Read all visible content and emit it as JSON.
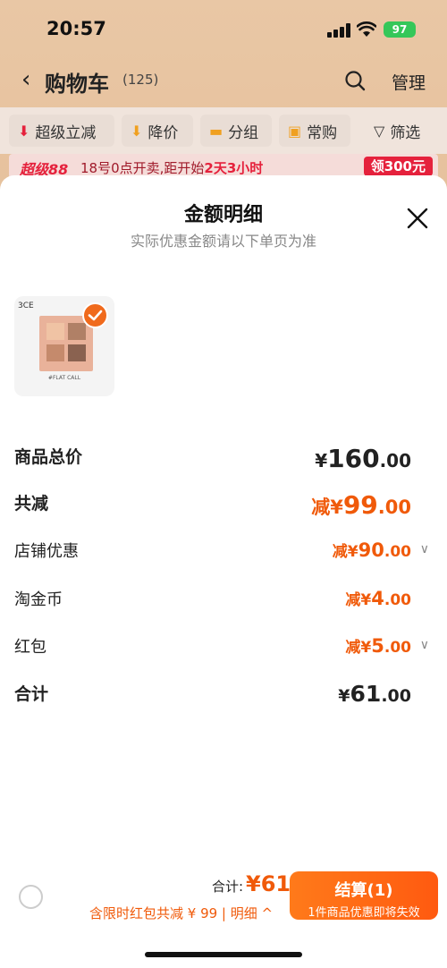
{
  "status_bar": {
    "time": "20:57",
    "battery": "97"
  },
  "header": {
    "title": "购物车",
    "count": "(125)",
    "manage": "管理"
  },
  "filters": [
    {
      "label": "超级立减",
      "icon": "arrow-down-icon"
    },
    {
      "label": "降价",
      "icon": "price-drop-icon"
    },
    {
      "label": "分组",
      "icon": "folder-icon"
    },
    {
      "label": "常购",
      "icon": "cart-icon"
    },
    {
      "label": "筛选",
      "icon": "filter-icon"
    }
  ],
  "promo": {
    "tag": "超级88",
    "text_a": "18号0点开卖,距开始",
    "text_b": "2天3小时",
    "coupon": "领300元"
  },
  "sheet": {
    "title": "金额明细",
    "subtitle": "实际优惠金额请以下单页为准",
    "product_brand": "3CE",
    "product_caption": "#FLAT CALL",
    "rows": [
      {
        "label": "商品总价",
        "currency": "¥",
        "int": "160",
        "dec": ".00",
        "prefix": ""
      },
      {
        "label": "共减",
        "currency": "¥",
        "int": "99",
        "dec": ".00",
        "prefix": "减"
      },
      {
        "label": "店铺优惠",
        "currency": "¥",
        "int": "90",
        "dec": ".00",
        "prefix": "减"
      },
      {
        "label": "淘金币",
        "currency": "¥",
        "int": "4",
        "dec": ".00",
        "prefix": "减"
      },
      {
        "label": "红包",
        "currency": "¥",
        "int": "5",
        "dec": ".00",
        "prefix": "减"
      },
      {
        "label": "合计",
        "currency": "¥",
        "int": "61",
        "dec": ".00",
        "prefix": ""
      }
    ]
  },
  "bottom": {
    "total_label": "合计:",
    "total_value": "¥61",
    "discount": "含限时红包共减 ¥ 99 | 明细 ^",
    "checkout_label": "结算(1)",
    "checkout_sub": "1件商品优惠即将失效"
  },
  "colors": {
    "accent": "#f05a0a",
    "promo_red": "#e5213c"
  }
}
